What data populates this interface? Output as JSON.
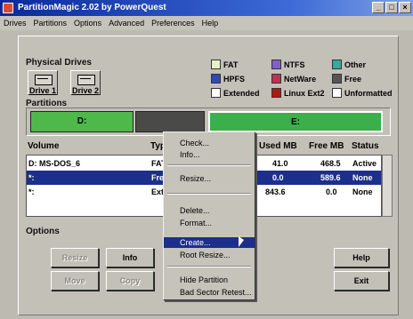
{
  "window": {
    "title": "PartitionMagic 2.02 by PowerQuest"
  },
  "menu": [
    "Drives",
    "Partitions",
    "Options",
    "Advanced",
    "Preferences",
    "Help"
  ],
  "physical_drives": {
    "label": "Physical Drives",
    "drives": [
      {
        "label": "Drive 1"
      },
      {
        "label": "Drive 2"
      }
    ]
  },
  "legend": [
    {
      "label": "FAT",
      "color": "#e8f0c8"
    },
    {
      "label": "NTFS",
      "color": "#8060c8"
    },
    {
      "label": "Other",
      "color": "#3aa89a"
    },
    {
      "label": "HPFS",
      "color": "#3048b8"
    },
    {
      "label": "NetWare",
      "color": "#c03050"
    },
    {
      "label": "Free",
      "color": "#555555"
    },
    {
      "label": "Extended",
      "color": "#ffffff"
    },
    {
      "label": "Linux Ext2",
      "color": "#b01818"
    },
    {
      "label": "Unformatted",
      "color": "#ffffff"
    }
  ],
  "partitions": {
    "label": "Partitions",
    "segments": [
      {
        "label": "D:"
      },
      {
        "label": ""
      },
      {
        "label": "E:"
      }
    ]
  },
  "table": {
    "headers": [
      "Volume",
      "Type",
      "Used MB",
      "Free MB",
      "Status"
    ],
    "rows": [
      {
        "volume": "D: MS-DOS_6",
        "type": "FAT",
        "used": "41.0",
        "free": "468.5",
        "status": "Active"
      },
      {
        "volume": "*:",
        "type": "Free Spa",
        "used": "0.0",
        "free": "589.6",
        "status": "None"
      },
      {
        "volume": "*:",
        "type": "Extended",
        "used": "843.6",
        "free": "0.0",
        "status": "None"
      }
    ]
  },
  "options": {
    "label": "Options",
    "buttons": [
      "Info",
      "Help",
      "Move",
      "Exit"
    ]
  },
  "context_menu": {
    "items": [
      "Check...",
      "Info...",
      "Resize...",
      "Delete...",
      "Format...",
      "Create...",
      "Root Resize...",
      "Hide Partition",
      "Bad Sector Retest..."
    ]
  }
}
